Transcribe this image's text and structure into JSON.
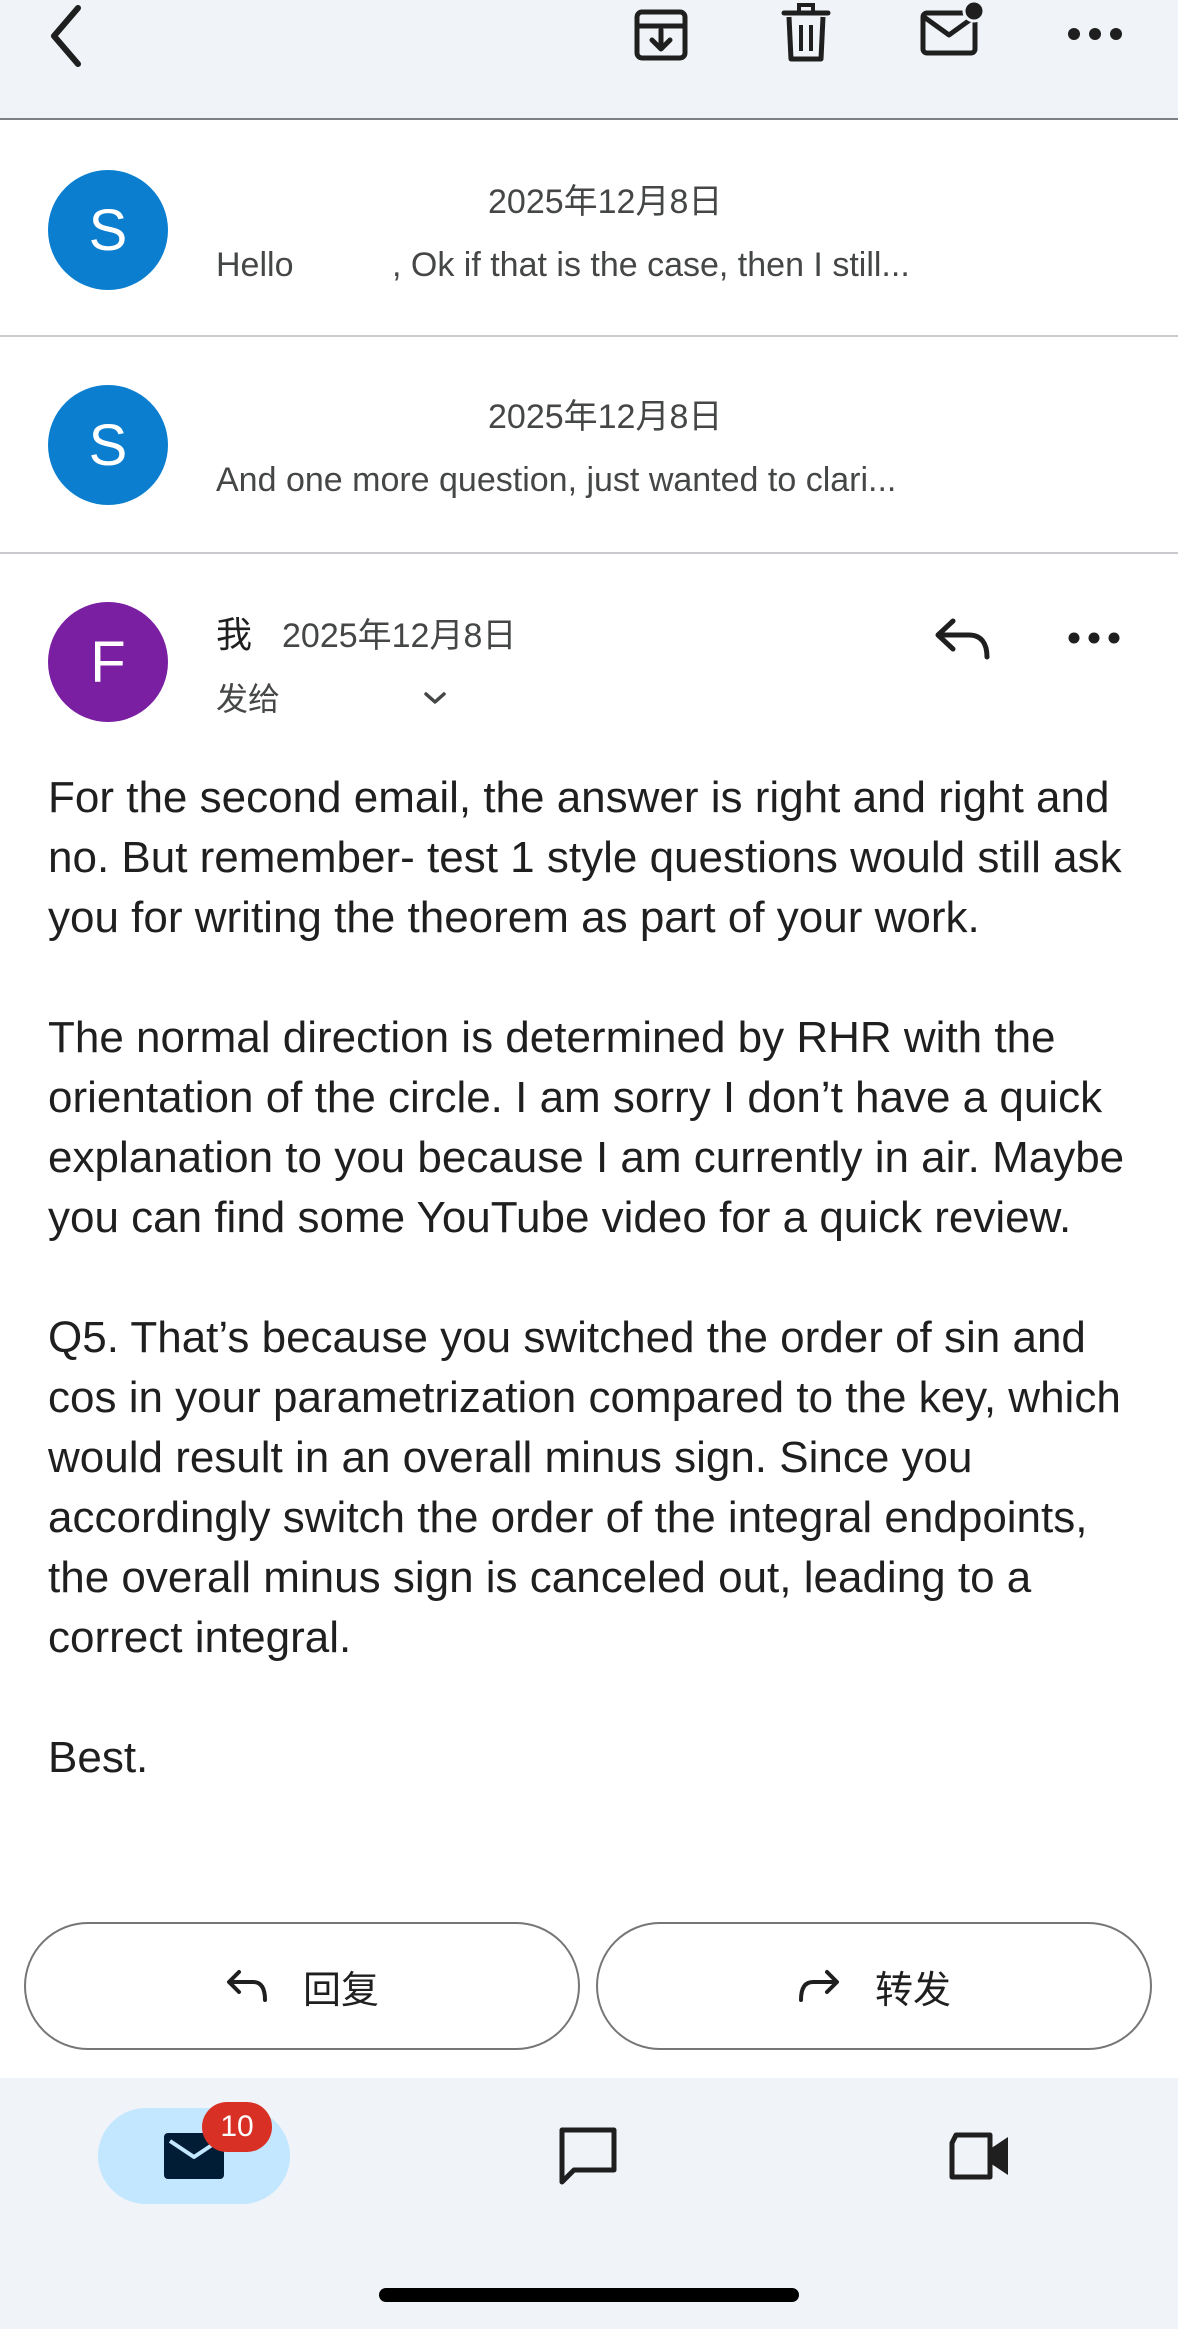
{
  "toolbar": {
    "back_icon": "chevron-left-icon",
    "archive_icon": "archive-icon",
    "delete_icon": "trash-icon",
    "mark_unread_icon": "mail-unread-icon",
    "more_icon": "more-horizontal-icon"
  },
  "thread": {
    "collapsed": [
      {
        "avatar_letter": "S",
        "avatar_color": "#0b7ed0",
        "date": "2025年12月8日",
        "snippet_start": "Hello",
        "snippet_rest": ", Ok if that is the case, then I still..."
      },
      {
        "avatar_letter": "S",
        "avatar_color": "#0b7ed0",
        "date": "2025年12月8日",
        "snippet": "And one more question, just wanted to clari..."
      }
    ],
    "open_message": {
      "avatar_letter": "F",
      "avatar_color": "#7b1fa2",
      "sender": "我",
      "date": "2025年12月8日",
      "to_label": "发给",
      "body": [
        "For the second email, the answer is right and right and no. But remember- test 1 style questions would still ask you for writing the theorem as part of your work.",
        "The normal direction is determined by RHR with the orientation of the circle. I am sorry I don’t have a quick explanation to you because I am currently in air. Maybe you can find some YouTube video for a quick review.",
        "Q5. That’s because you switched the order of sin and cos in your parametrization compared to the key, which would result in an overall minus sign. Since you accordingly switch the order of the integral endpoints, the overall minus sign is canceled out, leading to a correct integral.",
        "Best."
      ]
    }
  },
  "actions": {
    "reply_label": "回复",
    "forward_label": "转发"
  },
  "bottom_nav": {
    "mail_badge": "10",
    "accent_color": "#c2e7ff",
    "badge_color": "#d93025"
  }
}
